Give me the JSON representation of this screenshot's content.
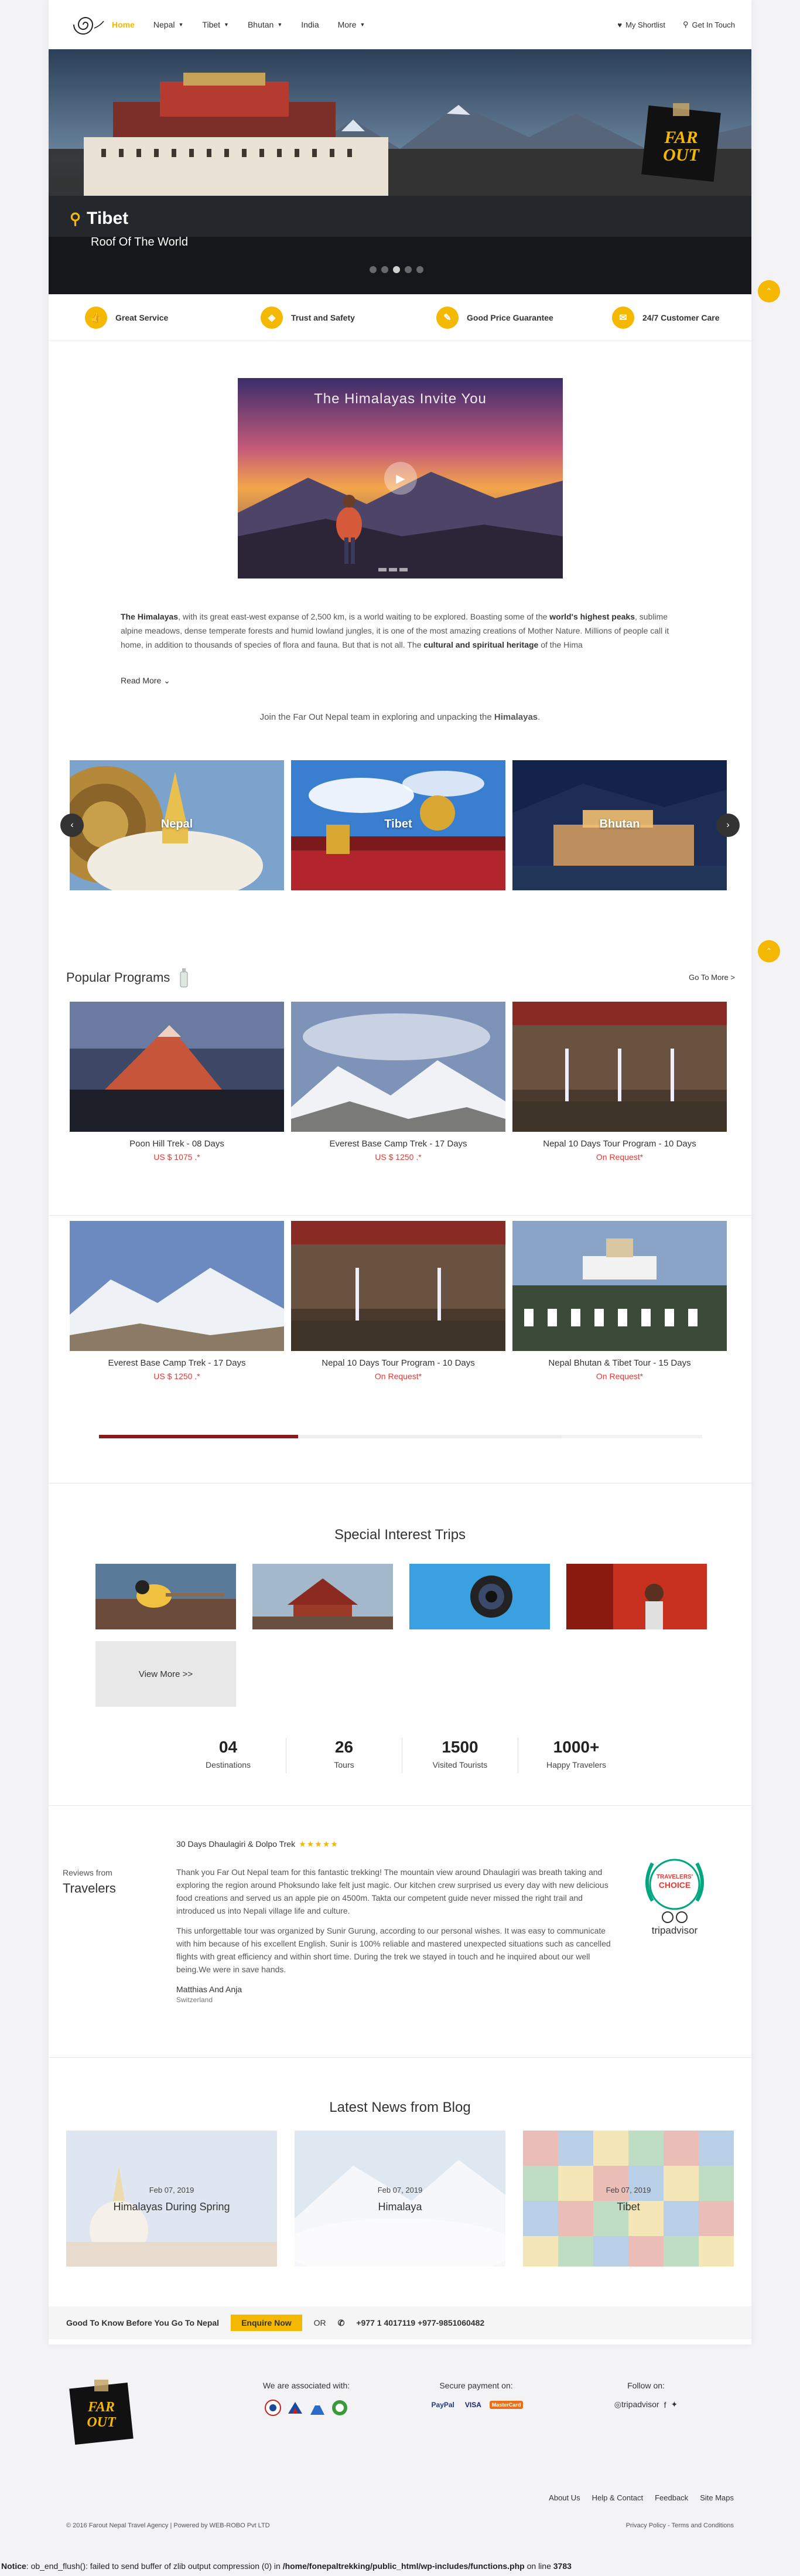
{
  "nav": {
    "items": [
      {
        "label": "Home",
        "active": true,
        "dropdown": false
      },
      {
        "label": "Nepal",
        "dropdown": true
      },
      {
        "label": "Tibet",
        "dropdown": true
      },
      {
        "label": "Bhutan",
        "dropdown": true
      },
      {
        "label": "India",
        "dropdown": false
      },
      {
        "label": "More",
        "dropdown": true
      }
    ],
    "shortlist": "My Shortlist",
    "get_in_touch": "Get In Touch"
  },
  "hero": {
    "title": "Tibet",
    "subtitle": "Roof Of The World",
    "slide_count": 5,
    "active_slide": 2,
    "badge_line1": "FAR",
    "badge_line2": "OUT"
  },
  "features": [
    {
      "label": "Great Service",
      "icon": "thumbs-up-icon"
    },
    {
      "label": "Trust and Safety",
      "icon": "shield-icon"
    },
    {
      "label": "Good Price Guarantee",
      "icon": "tag-icon"
    },
    {
      "label": "24/7 Customer Care",
      "icon": "chat-icon"
    }
  ],
  "video": {
    "title": "The Himalayas Invite You"
  },
  "intro": {
    "p1": "The Himalayas",
    "p2": ", with its great east-west expanse of 2,500 km, is a world waiting to be explored. Boasting some of the ",
    "p3": "world's highest peaks",
    "p4": ", sublime alpine meadows, dense temperate forests and humid lowland jungles, it is one of the most amazing creations of Mother Nature. Millions of people call it home, in addition to thousands of species of flora and fauna. But that is not all. The ",
    "p5": "cultural and spiritual heritage",
    "p6": " of the Hima",
    "read_more": "Read More",
    "join_text": "Join the Far Out Nepal team in exploring and unpacking the ",
    "join_bold": "Himalayas",
    "join_end": "."
  },
  "destinations": [
    "Nepal",
    "Tibet",
    "Bhutan"
  ],
  "popular": {
    "title": "Popular Programs",
    "go_more": "Go To More >",
    "row1": [
      {
        "name": "Poon Hill Trek - 08 Days",
        "price": "US $ 1075 .*"
      },
      {
        "name": "Everest Base Camp Trek - 17 Days",
        "price": "US $ 1250 .*"
      },
      {
        "name": "Nepal 10 Days Tour Program - 10 Days",
        "price": "On Request*"
      }
    ],
    "row2": [
      {
        "name": "Everest Base Camp Trek - 17 Days",
        "price": "US $ 1250 .*"
      },
      {
        "name": "Nepal 10 Days Tour Program - 10 Days",
        "price": "On Request*"
      },
      {
        "name": "Nepal Bhutan & Tibet Tour - 15 Days",
        "price": "On Request*"
      }
    ]
  },
  "special": {
    "title": "Special Interest Trips",
    "view_more": "View More >>"
  },
  "stats": [
    {
      "num": "04",
      "label": "Destinations"
    },
    {
      "num": "26",
      "label": "Tours"
    },
    {
      "num": "1500",
      "label": "Visited Tourists"
    },
    {
      "num": "1000+",
      "label": "Happy Travelers"
    }
  ],
  "reviews": {
    "label_top": "Reviews from",
    "label_main": "Travelers",
    "title": "30 Days Dhaulagiri & Dolpo Trek",
    "stars": "★★★★★",
    "p1": "Thank you Far Out Nepal team for this fantastic trekking! The mountain view around Dhaulagiri was breath taking and exploring the region around Phoksundo lake felt just magic. Our kitchen crew surprised us every day with new delicious food creations and served us an apple pie on 4500m. Takta our competent guide never missed the right trail and introduced us into Nepali village life and culture.",
    "p2": "This unforgettable tour was organized by Sunir Gurung, according to our personal wishes. It was easy to communicate with him because of his excellent English. Sunir is 100% reliable and mastered unexpected situations such as cancelled flights with great efficiency and within short time. During the trek we stayed in touch and he inquired about our well being.We were in save hands.",
    "reviewer": "Matthias And Anja",
    "reviewer_from": "Switzerland",
    "ta_line1": "TRAVELERS'",
    "ta_line2": "CHOICE",
    "ta_brand": "tripadvisor"
  },
  "blog": {
    "title": "Latest News from Blog",
    "posts": [
      {
        "date": "Feb 07, 2019",
        "title": "Himalayas During Spring"
      },
      {
        "date": "Feb 07, 2019",
        "title": "Himalaya"
      },
      {
        "date": "Feb 07, 2019",
        "title": "Tibet"
      }
    ]
  },
  "enquiry": {
    "text": "Good To Know Before You Go To Nepal",
    "button": "Enquire Now",
    "or": "OR",
    "phone": "+977 1 4017119 +977-9851060482"
  },
  "footer": {
    "associated": "We are associated with:",
    "secure": "Secure payment on:",
    "follow": "Follow on:",
    "pay": [
      "PayPal",
      "VISA",
      "MasterCard"
    ],
    "ta": "tripadvisor",
    "links": [
      "About Us",
      "Help & Contact",
      "Feedback",
      "Site Maps"
    ],
    "copyright": "© 2016 Farout Nepal Travel Agency | Powered by WEB-ROBO Pvt LTD",
    "policy": "Privacy Policy - Terms and Conditions"
  },
  "notice": {
    "label": "Notice",
    "text": ": ob_end_flush(): failed to send buffer of zlib output compression (0) in ",
    "path": "/home/fonepaltrekking/public_html/wp-includes/functions.php",
    "line_text": " on line ",
    "line": "3783"
  },
  "colors": {
    "accent": "#f5b800",
    "price_red": "#e53935"
  }
}
